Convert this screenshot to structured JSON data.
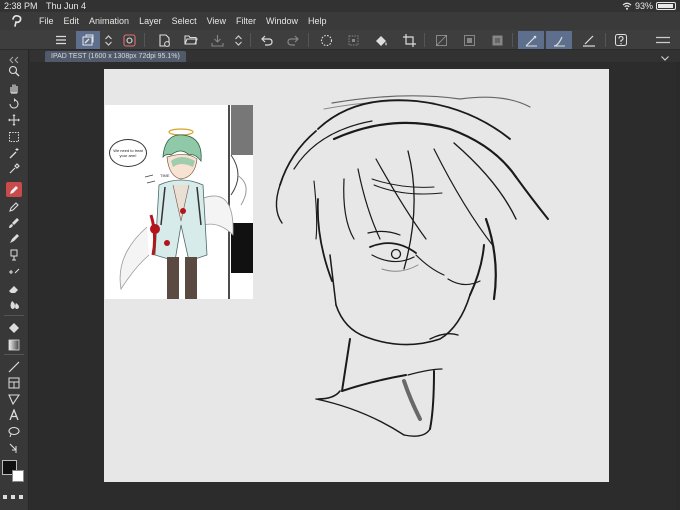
{
  "status_bar": {
    "time": "2:38 PM",
    "date": "Thu Jun 4",
    "battery": "93%",
    "battery_level": 0.93
  },
  "menu": {
    "items": [
      "File",
      "Edit",
      "Animation",
      "Layer",
      "Select",
      "View",
      "Filter",
      "Window",
      "Help"
    ]
  },
  "toolbar": {
    "icons": [
      "menu-icon",
      "layer-property-icon",
      "chevron-updown-icon",
      "settings-icon",
      "new-canvas-icon",
      "open-icon",
      "save-icon",
      "chevron-updown-icon",
      "undo-icon",
      "redo-icon",
      "loading-icon",
      "transform-icon",
      "fill-icon",
      "crop-icon",
      "select-all-icon",
      "deselect-icon",
      "invert-selection-icon",
      "snap-ruler-icon",
      "snap-special-ruler-icon",
      "stabilizer-icon",
      "help-icon"
    ]
  },
  "document": {
    "tab_title": "IPAD TEST (1600 x 1308px 72dpi 95.1%)"
  },
  "reference_image": {
    "speech_bubble": "We need to treat your arm!",
    "caption": "TIME"
  },
  "tools": {
    "items": [
      "zoom-icon",
      "hand-icon",
      "rotate-icon",
      "move-icon",
      "selection-icon",
      "magic-wand-icon",
      "eyedropper-icon",
      "pen-icon",
      "pencil-icon",
      "brush-icon",
      "airbrush-icon",
      "decoration-icon",
      "eraser-icon",
      "blend-icon",
      "fill-icon",
      "gradient-icon",
      "line-icon",
      "frame-icon",
      "figure-icon",
      "text-icon",
      "lasso-icon",
      "correction-icon"
    ],
    "selected": "pen-icon",
    "main_color": "#111111",
    "sub_color": "#ffffff"
  },
  "colors": {
    "accent": "#5d6f8c",
    "active_tool": "#c94a4a",
    "canvas": "#e7e7e7"
  }
}
